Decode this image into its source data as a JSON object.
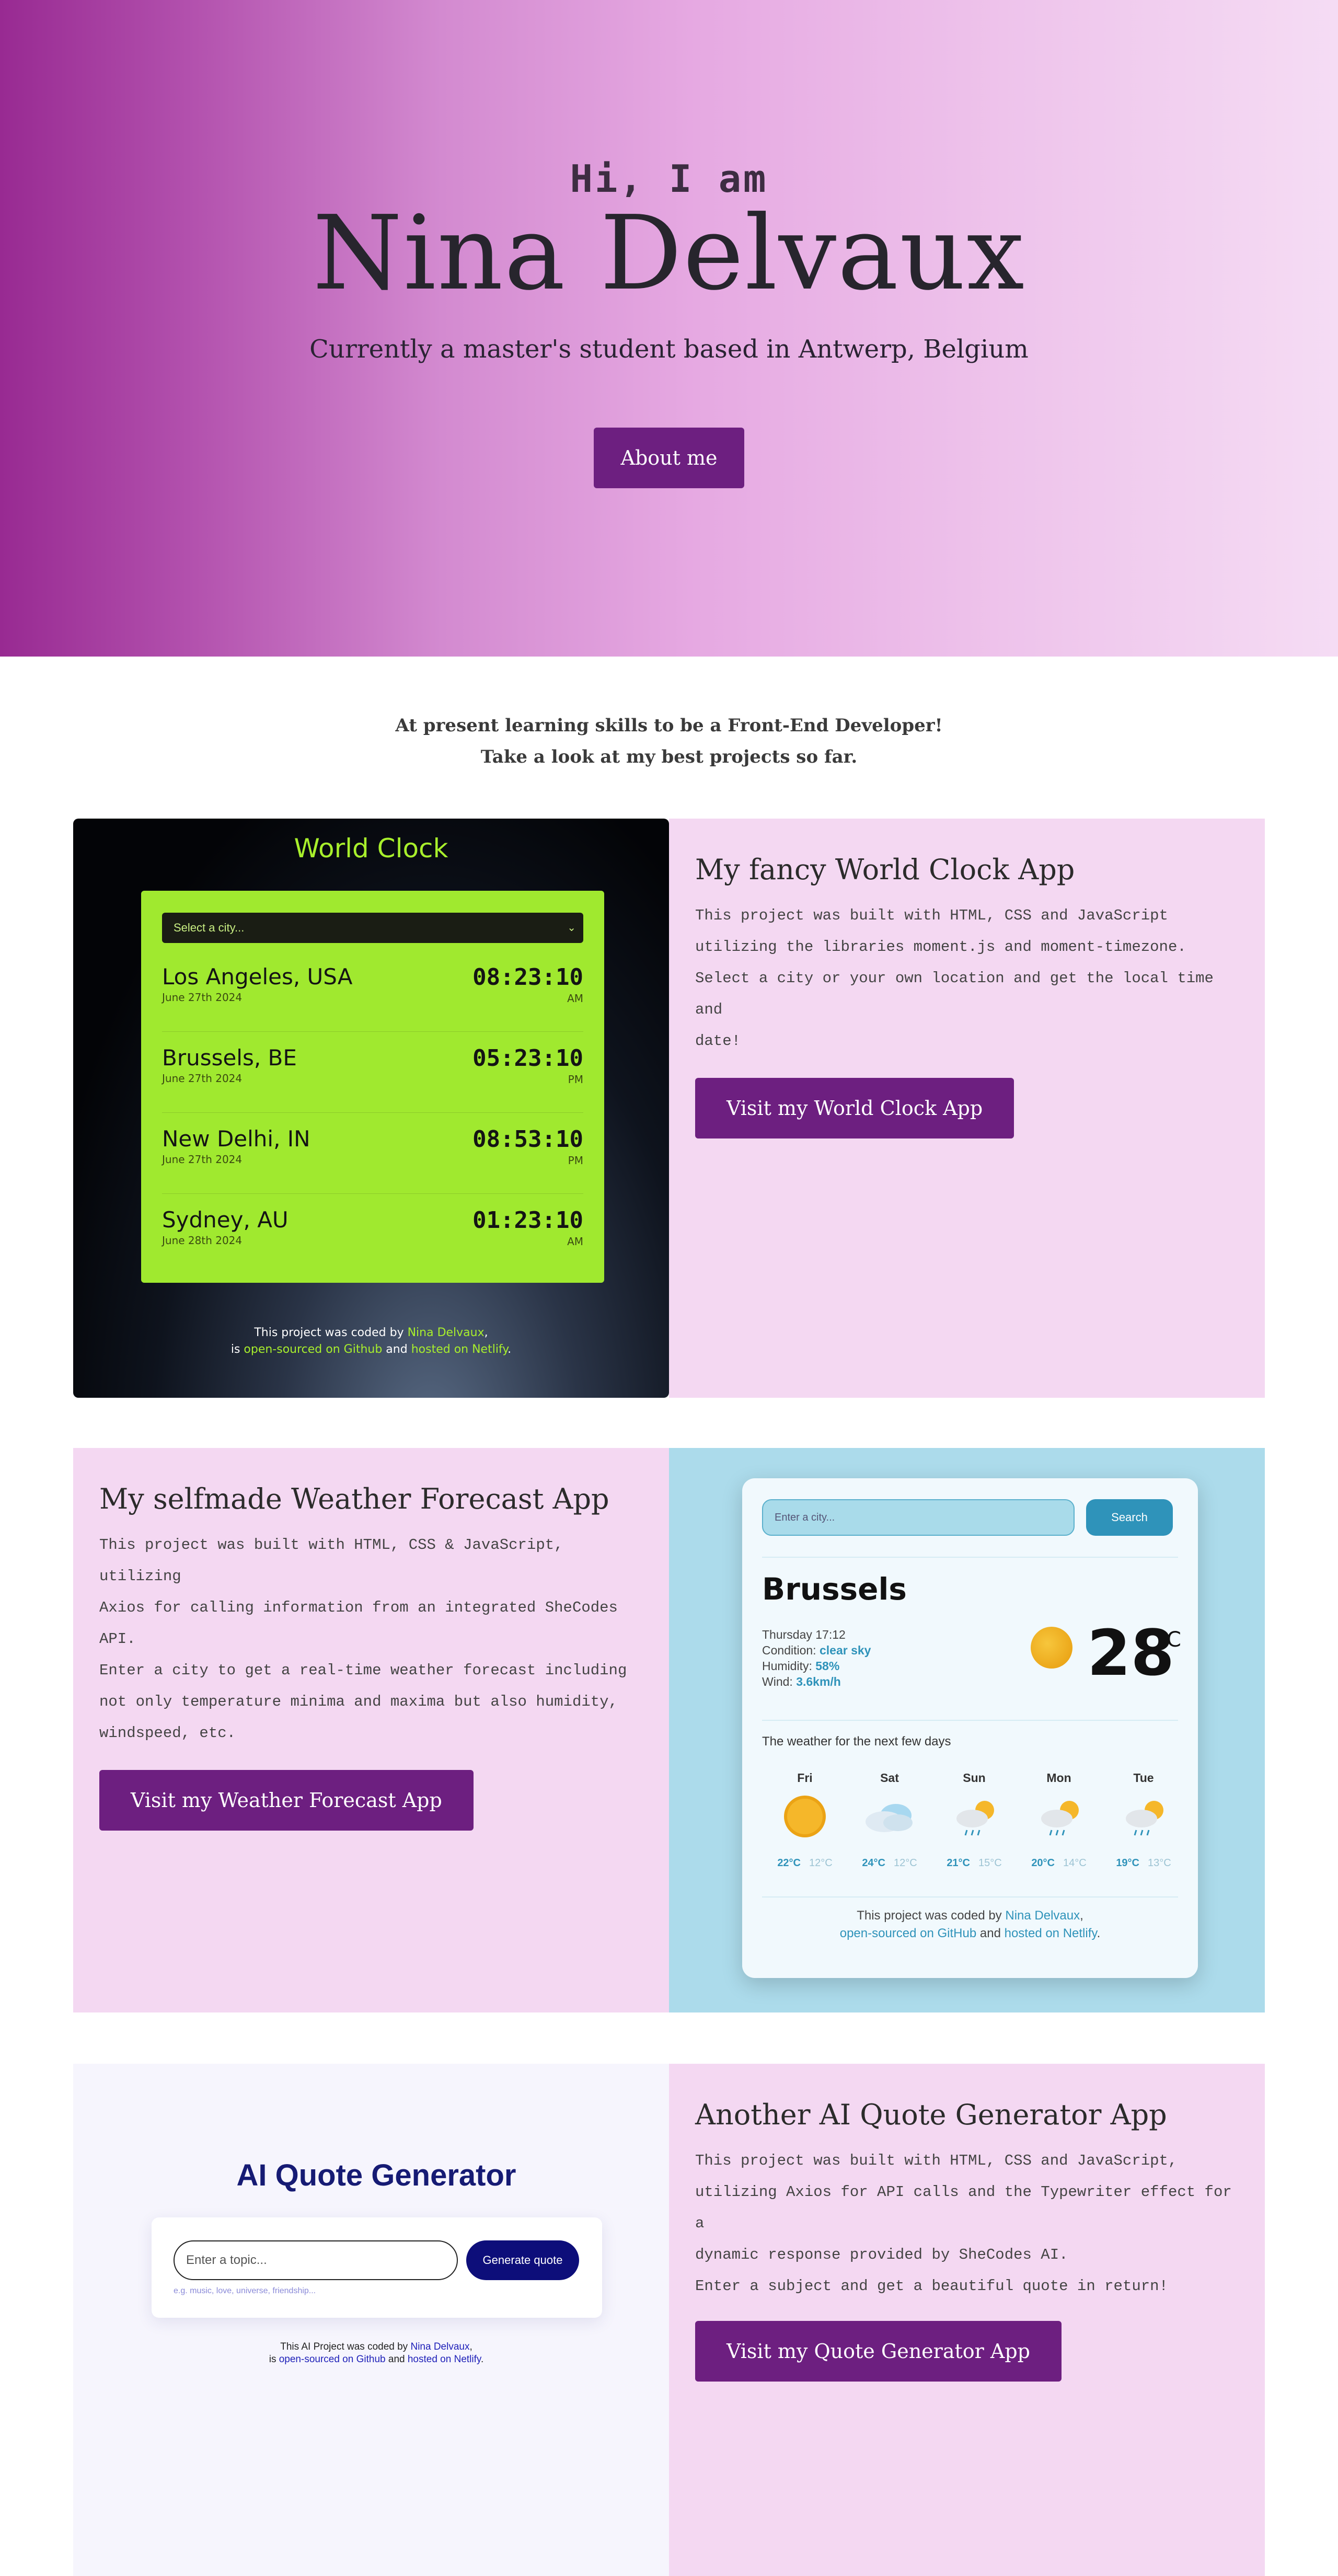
{
  "hero": {
    "greeting": "Hi, I am",
    "name": "Nina Delvaux",
    "subtitle": "Currently a master's student based in Antwerp, Belgium",
    "button": "About me"
  },
  "intro": {
    "line1": "At present learning skills to be a Front-End Developer!",
    "line2": "Take a look at my best projects so far."
  },
  "projects": [
    {
      "title": "My fancy World Clock App",
      "description": [
        "This project was built with HTML, CSS and JavaScript",
        "utilizing the libraries moment.js and moment-timezone.",
        "Select a city or your own location and get the local time and",
        "date!"
      ],
      "button": "Visit my World Clock App"
    },
    {
      "title": "My selfmade Weather Forecast App",
      "description": [
        "This project was built with HTML, CSS & JavaScript, utilizing",
        "Axios for calling information from an integrated SheCodes",
        "API.",
        "Enter a city to get a real-time weather forecast including",
        "not only temperature minima and maxima but also humidity,",
        "windspeed, etc."
      ],
      "button": "Visit my Weather Forecast App"
    },
    {
      "title": "Another AI Quote Generator App",
      "description": [
        "This project was built with HTML, CSS and JavaScript,",
        "utilizing Axios for API calls and the Typewriter effect for a",
        "dynamic response provided by SheCodes AI.",
        "Enter a subject and get a beautiful quote in return!"
      ],
      "button": "Visit my Quote Generator App"
    }
  ],
  "world_clock": {
    "title": "World Clock",
    "select_placeholder": "Select a city...",
    "cities": [
      {
        "name": "Los Angeles, USA",
        "date": "June 27th 2024",
        "time": "08:23:10",
        "ampm": "AM"
      },
      {
        "name": "Brussels, BE",
        "date": "June 27th 2024",
        "time": "05:23:10",
        "ampm": "PM"
      },
      {
        "name": "New Delhi, IN",
        "date": "June 27th 2024",
        "time": "08:53:10",
        "ampm": "PM"
      },
      {
        "name": "Sydney, AU",
        "date": "June 28th 2024",
        "time": "01:23:10",
        "ampm": "AM"
      }
    ],
    "footer": {
      "p1": "This project was coded by ",
      "link_name": "Nina Delvaux",
      "p2": ",",
      "p3": "is ",
      "link_github": "open-sourced on Github",
      "p4": " and ",
      "link_netlify": "hosted on Netlify",
      "p5": "."
    }
  },
  "weather": {
    "search_placeholder": "Enter a city...",
    "search_button": "Search",
    "city": "Brussels",
    "datetime": "Thursday 17:12",
    "condition_label": "Condition: ",
    "condition": "clear sky",
    "humidity_label": "Humidity: ",
    "humidity": "58%",
    "wind_label": "Wind: ",
    "wind": "3.6km/h",
    "temperature": "28",
    "unit": "°C",
    "forecast_title": "The weather for the next few days",
    "forecast": [
      {
        "day": "Fri",
        "icon": "sun-icon",
        "max": "22°C",
        "min": "12°C"
      },
      {
        "day": "Sat",
        "icon": "cloud-icon",
        "max": "24°C",
        "min": "12°C"
      },
      {
        "day": "Sun",
        "icon": "rain-sun-icon",
        "max": "21°C",
        "min": "15°C"
      },
      {
        "day": "Mon",
        "icon": "rain-sun-icon",
        "max": "20°C",
        "min": "14°C"
      },
      {
        "day": "Tue",
        "icon": "rain-sun-icon",
        "max": "19°C",
        "min": "13°C"
      }
    ],
    "footer": {
      "p1": "This project was coded by ",
      "link_name": "Nina Delvaux",
      "p2": ",",
      "link_github": "open-sourced on GitHub",
      "p3": " and ",
      "link_netlify": "hosted on Netlify",
      "p4": "."
    }
  },
  "quote": {
    "title": "AI Quote Generator",
    "input_placeholder": "Enter a topic...",
    "button": "Generate quote",
    "hint": "e.g. music, love, universe, friendship...",
    "footer": {
      "p1": "This AI Project was coded by ",
      "link_name": "Nina Delvaux",
      "p2": ",",
      "p3": "is ",
      "link_github": "open-sourced on Github",
      "p4": " and ",
      "link_netlify": "hosted on Netlify",
      "p5": "."
    }
  },
  "colors": {
    "accent": "#6d1f80",
    "panel_pink": "#f4d8f2",
    "clock_green": "#a0e92f",
    "weather_blue": "#2f93ba",
    "quote_navy": "#0d0e7a"
  }
}
